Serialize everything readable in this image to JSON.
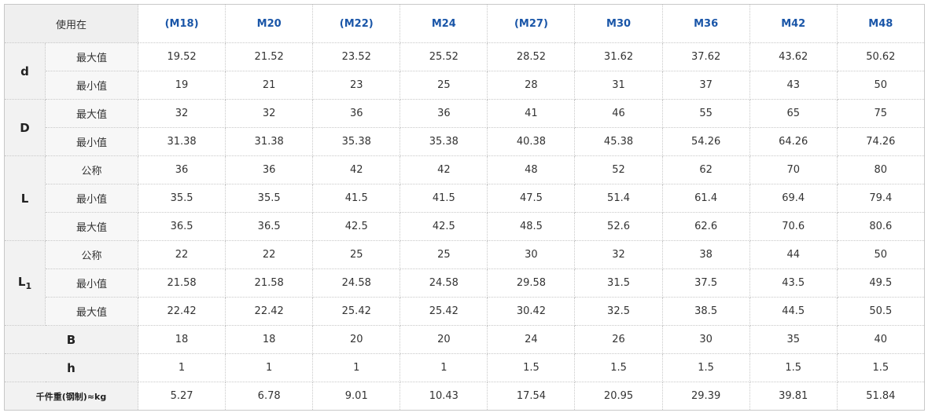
{
  "header": {
    "corner": "使用在",
    "sizes": [
      "(M18)",
      "M20",
      "(M22)",
      "M24",
      "(M27)",
      "M30",
      "M36",
      "M42",
      "M48"
    ]
  },
  "groups": {
    "d": {
      "label": "d",
      "rows": [
        {
          "sub": "最大值",
          "values": [
            "19.52",
            "21.52",
            "23.52",
            "25.52",
            "28.52",
            "31.62",
            "37.62",
            "43.62",
            "50.62"
          ]
        },
        {
          "sub": "最小值",
          "values": [
            "19",
            "21",
            "23",
            "25",
            "28",
            "31",
            "37",
            "43",
            "50"
          ]
        }
      ]
    },
    "D": {
      "label": "D",
      "rows": [
        {
          "sub": "最大值",
          "values": [
            "32",
            "32",
            "36",
            "36",
            "41",
            "46",
            "55",
            "65",
            "75"
          ]
        },
        {
          "sub": "最小值",
          "values": [
            "31.38",
            "31.38",
            "35.38",
            "35.38",
            "40.38",
            "45.38",
            "54.26",
            "64.26",
            "74.26"
          ]
        }
      ]
    },
    "L": {
      "label": "L",
      "rows": [
        {
          "sub": "公称",
          "values": [
            "36",
            "36",
            "42",
            "42",
            "48",
            "52",
            "62",
            "70",
            "80"
          ]
        },
        {
          "sub": "最小值",
          "values": [
            "35.5",
            "35.5",
            "41.5",
            "41.5",
            "47.5",
            "51.4",
            "61.4",
            "69.4",
            "79.4"
          ]
        },
        {
          "sub": "最大值",
          "values": [
            "36.5",
            "36.5",
            "42.5",
            "42.5",
            "48.5",
            "52.6",
            "62.6",
            "70.6",
            "80.6"
          ]
        }
      ]
    },
    "L1": {
      "label": "L",
      "subscript": "1",
      "rows": [
        {
          "sub": "公称",
          "values": [
            "22",
            "22",
            "25",
            "25",
            "30",
            "32",
            "38",
            "44",
            "50"
          ]
        },
        {
          "sub": "最小值",
          "values": [
            "21.58",
            "21.58",
            "24.58",
            "24.58",
            "29.58",
            "31.5",
            "37.5",
            "43.5",
            "49.5"
          ]
        },
        {
          "sub": "最大值",
          "values": [
            "22.42",
            "22.42",
            "25.42",
            "25.42",
            "30.42",
            "32.5",
            "38.5",
            "44.5",
            "50.5"
          ]
        }
      ]
    },
    "B": {
      "label": "B",
      "values": [
        "18",
        "18",
        "20",
        "20",
        "24",
        "26",
        "30",
        "35",
        "40"
      ]
    },
    "h": {
      "label": "h",
      "values": [
        "1",
        "1",
        "1",
        "1",
        "1.5",
        "1.5",
        "1.5",
        "1.5",
        "1.5"
      ]
    },
    "weight": {
      "label": "千件重(钢制)≈kg",
      "values": [
        "5.27",
        "6.78",
        "9.01",
        "10.43",
        "17.54",
        "20.95",
        "29.39",
        "39.81",
        "51.84"
      ]
    }
  }
}
